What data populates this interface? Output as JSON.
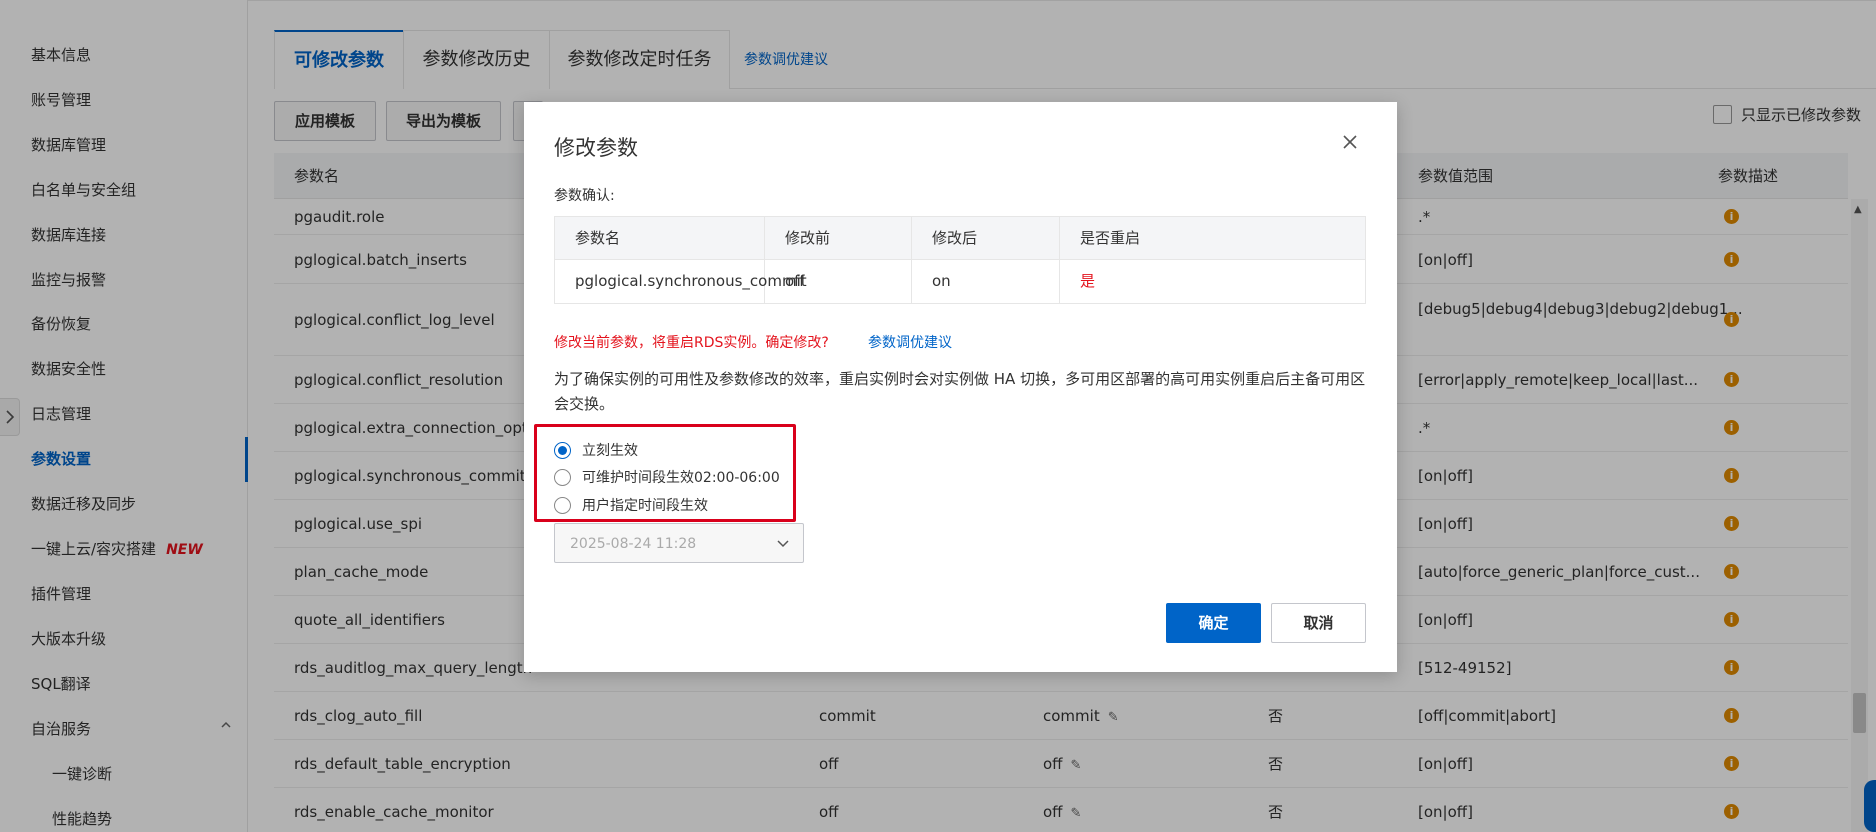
{
  "sidebar": {
    "items": [
      {
        "label": "基本信息"
      },
      {
        "label": "账号管理"
      },
      {
        "label": "数据库管理"
      },
      {
        "label": "白名单与安全组"
      },
      {
        "label": "数据库连接"
      },
      {
        "label": "监控与报警"
      },
      {
        "label": "备份恢复"
      },
      {
        "label": "数据安全性"
      },
      {
        "label": "日志管理"
      },
      {
        "label": "参数设置"
      },
      {
        "label": "数据迁移及同步"
      },
      {
        "label": "一键上云/容灾搭建"
      },
      {
        "label": "插件管理"
      },
      {
        "label": "大版本升级"
      },
      {
        "label": "SQL翻译"
      },
      {
        "label": "自治服务"
      },
      {
        "label": "一键诊断"
      },
      {
        "label": "性能趋势"
      }
    ],
    "new_badge": "NEW",
    "active_item": "参数设置"
  },
  "tabs": {
    "items": [
      "可修改参数",
      "参数修改历史",
      "参数修改定时任务"
    ],
    "link": "参数调优建议"
  },
  "toolbar": {
    "apply_template": "应用模板",
    "export_template": "导出为模板",
    "only_modified": "只显示已修改参数"
  },
  "table": {
    "headers": {
      "name": "参数名",
      "range": "参数值范围",
      "desc": "参数描述"
    },
    "rows": [
      {
        "name": "pgaudit.role",
        "default": "",
        "current": "",
        "restart": "",
        "range": ".*"
      },
      {
        "name": "pglogical.batch_inserts",
        "default": "",
        "current": "",
        "restart": "",
        "range": "[on|off]"
      },
      {
        "name": "pglogical.conflict_log_level",
        "default": "",
        "current": "",
        "restart": "",
        "range": "[debug5|debug4|debug3|debug2|debug1..."
      },
      {
        "name": "pglogical.conflict_resolution",
        "default": "",
        "current": "",
        "restart": "",
        "range": "[error|apply_remote|keep_local|last..."
      },
      {
        "name": "pglogical.extra_connection_options",
        "default": "",
        "current": "",
        "restart": "",
        "range": ".*"
      },
      {
        "name": "pglogical.synchronous_commit",
        "default": "",
        "current": "",
        "restart": "",
        "range": "[on|off]"
      },
      {
        "name": "pglogical.use_spi",
        "default": "",
        "current": "",
        "restart": "",
        "range": "[on|off]"
      },
      {
        "name": "plan_cache_mode",
        "default": "",
        "current": "",
        "restart": "",
        "range": "[auto|force_generic_plan|force_cust..."
      },
      {
        "name": "quote_all_identifiers",
        "default": "",
        "current": "",
        "restart": "",
        "range": "[on|off]"
      },
      {
        "name": "rds_auditlog_max_query_length",
        "default": "",
        "current": "",
        "restart": "",
        "range": "[512-49152]"
      },
      {
        "name": "rds_clog_auto_fill",
        "default": "commit",
        "current": "commit",
        "restart": "否",
        "range": "[off|commit|abort]"
      },
      {
        "name": "rds_default_table_encryption",
        "default": "off",
        "current": "off",
        "restart": "否",
        "range": "[on|off]"
      },
      {
        "name": "rds_enable_cache_monitor",
        "default": "off",
        "current": "off",
        "restart": "否",
        "range": "[on|off]"
      }
    ]
  },
  "modal": {
    "title": "修改参数",
    "confirm_label": "参数确认:",
    "table_headers": [
      "参数名",
      "修改前",
      "修改后",
      "是否重启"
    ],
    "table_row": [
      "pglogical.synchronous_commit",
      "off",
      "on",
      "是"
    ],
    "warning": "修改当前参数，将重启RDS实例。确定修改?",
    "warning_link": "参数调优建议",
    "description": "为了确保实例的可用性及参数修改的效率，重启实例时会对实例做 HA 切换，多可用区部署的高可用实例重启后主备可用区会交换。",
    "options": [
      "立刻生效",
      "可维护时间段生效02:00-06:00",
      "用户指定时间段生效"
    ],
    "selected_option": 0,
    "datetime": "2025-08-24 11:28",
    "ok": "确定",
    "cancel": "取消"
  },
  "colors": {
    "accent": "#0064c8",
    "danger": "#e4141e",
    "warning_icon": "#e08a00",
    "brand": "#ff6a00"
  }
}
